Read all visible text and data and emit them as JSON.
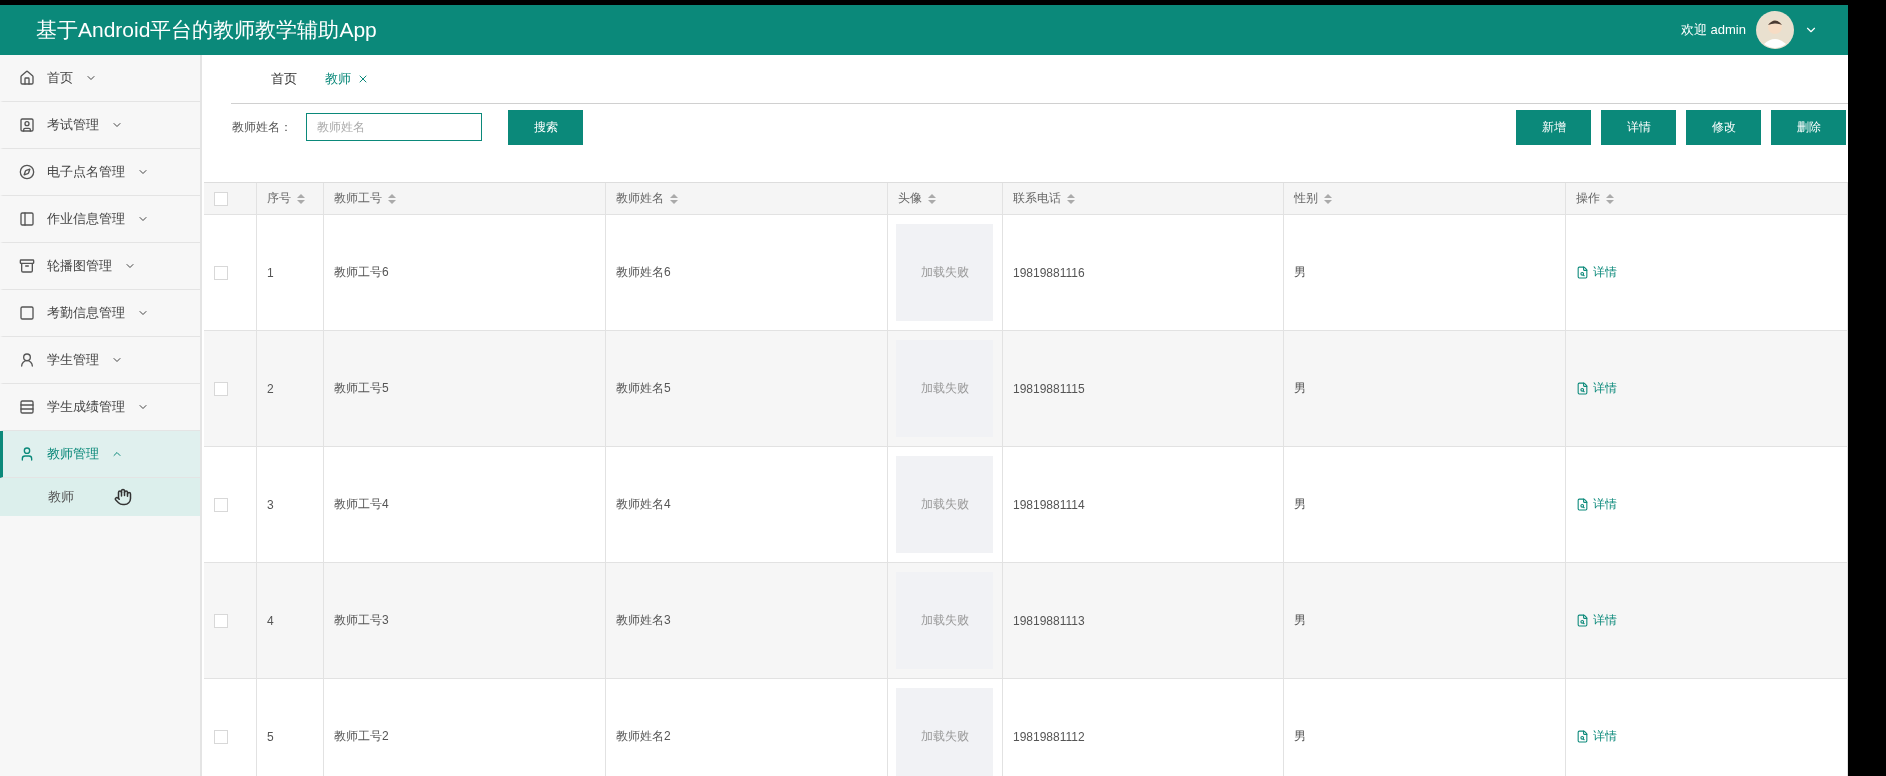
{
  "header": {
    "title": "基于Android平台的教师教学辅助App",
    "welcome": "欢迎 admin"
  },
  "sidebar": {
    "items": [
      {
        "label": "首页",
        "expanded": false,
        "selected": false
      },
      {
        "label": "考试管理",
        "expanded": false,
        "selected": false
      },
      {
        "label": "电子点名管理",
        "expanded": false,
        "selected": false
      },
      {
        "label": "作业信息管理",
        "expanded": false,
        "selected": false
      },
      {
        "label": "轮播图管理",
        "expanded": false,
        "selected": false
      },
      {
        "label": "考勤信息管理",
        "expanded": false,
        "selected": false
      },
      {
        "label": "学生管理",
        "expanded": false,
        "selected": false
      },
      {
        "label": "学生成绩管理",
        "expanded": false,
        "selected": false
      },
      {
        "label": "教师管理",
        "expanded": true,
        "selected": true,
        "children": [
          {
            "label": "教师",
            "selected": true
          }
        ]
      }
    ]
  },
  "tabs": [
    {
      "label": "首页",
      "selected": false,
      "closable": false
    },
    {
      "label": "教师",
      "selected": true,
      "closable": true
    }
  ],
  "search": {
    "label": "教师姓名：",
    "placeholder": "教师姓名",
    "button": "搜索"
  },
  "actions": [
    "新增",
    "详情",
    "修改",
    "删除"
  ],
  "table": {
    "select_all_checked": false,
    "columns": [
      "序号",
      "教师工号",
      "教师姓名",
      "头像",
      "联系电话",
      "性别",
      "操作"
    ],
    "rows": [
      {
        "checked": false,
        "index": "1",
        "id": "教师工号6",
        "name": "教师姓名6",
        "avatar": "加载失败",
        "phone": "19819881116",
        "gender": "男",
        "action": "详情"
      },
      {
        "checked": false,
        "index": "2",
        "id": "教师工号5",
        "name": "教师姓名5",
        "avatar": "加载失败",
        "phone": "19819881115",
        "gender": "男",
        "action": "详情"
      },
      {
        "checked": false,
        "index": "3",
        "id": "教师工号4",
        "name": "教师姓名4",
        "avatar": "加载失败",
        "phone": "19819881114",
        "gender": "男",
        "action": "详情"
      },
      {
        "checked": false,
        "index": "4",
        "id": "教师工号3",
        "name": "教师姓名3",
        "avatar": "加载失败",
        "phone": "19819881113",
        "gender": "男",
        "action": "详情"
      },
      {
        "checked": false,
        "index": "5",
        "id": "教师工号2",
        "name": "教师姓名2",
        "avatar": "加载失败",
        "phone": "19819881112",
        "gender": "男",
        "action": "详情"
      }
    ]
  }
}
